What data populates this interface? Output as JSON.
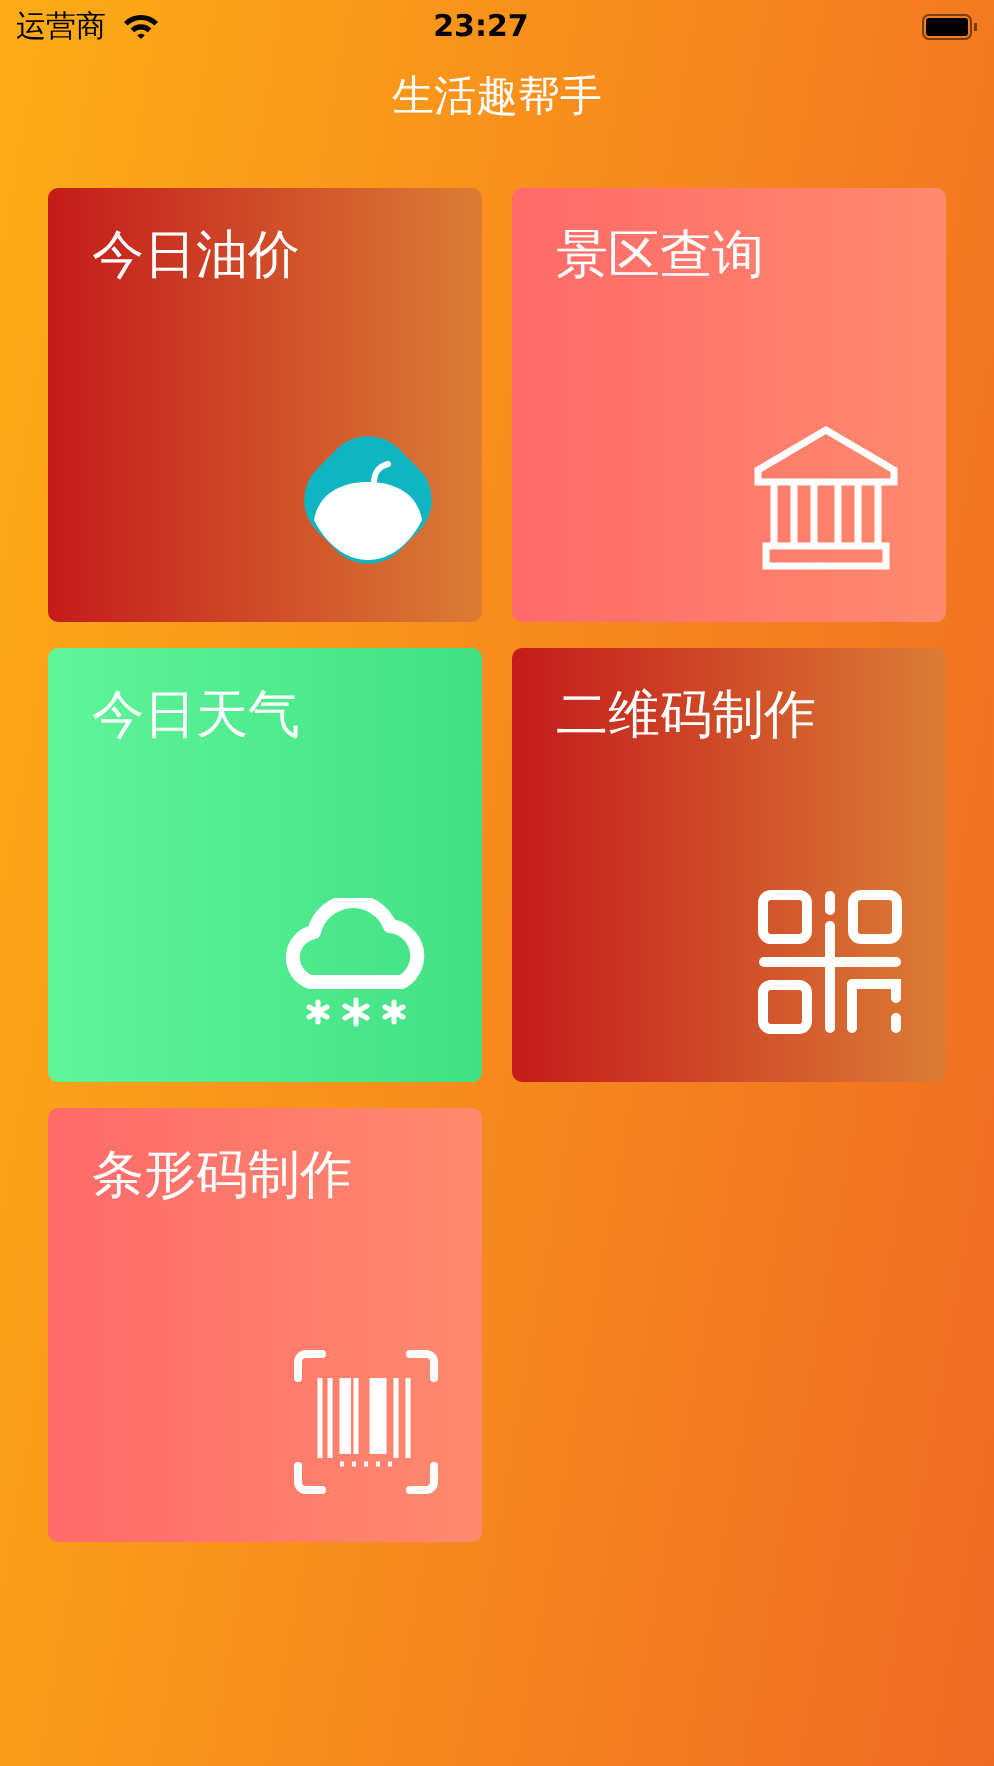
{
  "status_bar": {
    "carrier": "运营商",
    "time": "23:27"
  },
  "title": "生活趣帮手",
  "tiles": [
    {
      "label": "今日油价",
      "kind": "oil",
      "color": "#c41b1b"
    },
    {
      "label": "景区查询",
      "kind": "scenic",
      "color": "#ff6a6a"
    },
    {
      "label": "今日天气",
      "kind": "weather",
      "color": "#60f59a"
    },
    {
      "label": "二维码制作",
      "kind": "qrcode",
      "color": "#c41b1b"
    },
    {
      "label": "条形码制作",
      "kind": "barcode",
      "color": "#ff6a6a"
    }
  ]
}
